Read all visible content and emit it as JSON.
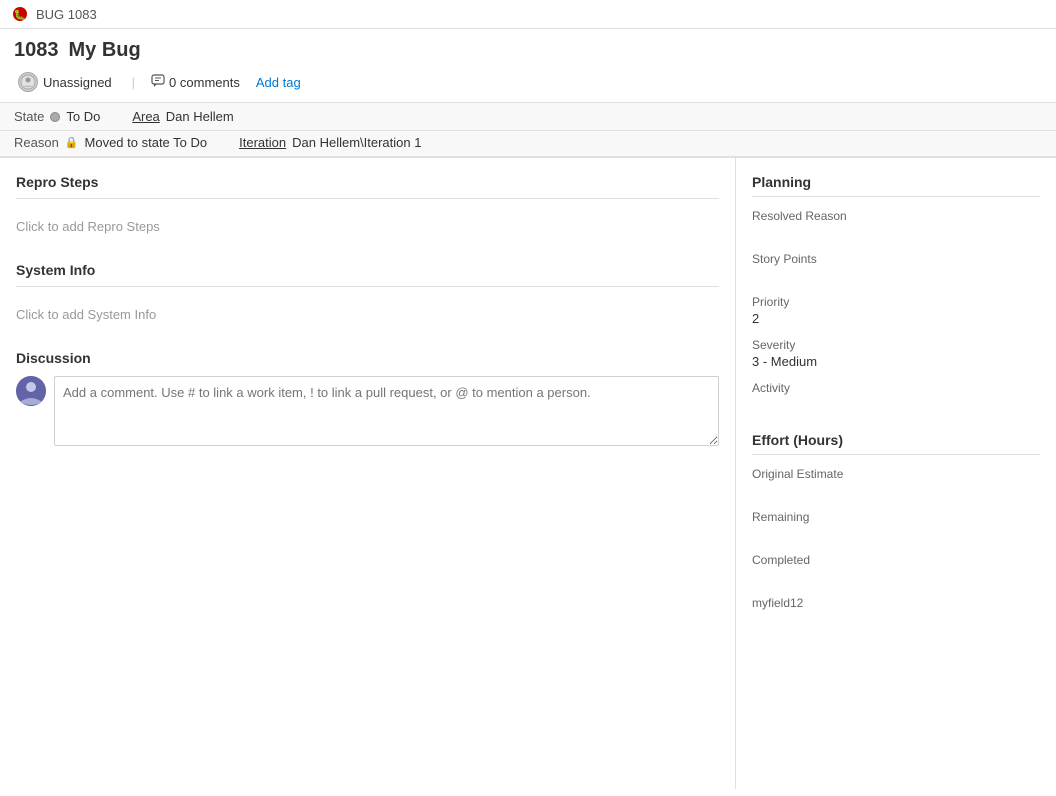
{
  "titleBar": {
    "bugLabel": "BUG 1083",
    "bugIconColor": "#cc0000"
  },
  "workItem": {
    "id": "1083",
    "title": "My Bug",
    "assignedTo": "Unassigned",
    "commentsCount": "0 comments",
    "addTagLabel": "Add tag"
  },
  "fields": {
    "stateLabel": "State",
    "stateValue": "To Do",
    "areaLabel": "Area",
    "areaValue": "Dan Hellem",
    "reasonLabel": "Reason",
    "reasonValue": "Moved to state To Do",
    "iterationLabel": "Iteration",
    "iterationValue": "Dan Hellem\\Iteration 1"
  },
  "leftPane": {
    "reproStepsTitle": "Repro Steps",
    "reproStepsPlaceholder": "Click to add Repro Steps",
    "systemInfoTitle": "System Info",
    "systemInfoPlaceholder": "Click to add System Info",
    "discussionTitle": "Discussion",
    "commentPlaceholder": "Add a comment. Use # to link a work item, ! to link a pull request, or @ to mention a person."
  },
  "rightPane": {
    "planningTitle": "Planning",
    "resolvedReasonLabel": "Resolved Reason",
    "resolvedReasonValue": "",
    "storyPointsLabel": "Story Points",
    "storyPointsValue": "",
    "priorityLabel": "Priority",
    "priorityValue": "2",
    "severityLabel": "Severity",
    "severityValue": "3 - Medium",
    "activityLabel": "Activity",
    "activityValue": "",
    "effortTitle": "Effort (Hours)",
    "originalEstimateLabel": "Original Estimate",
    "originalEstimateValue": "",
    "remainingLabel": "Remaining",
    "remainingValue": "",
    "completedLabel": "Completed",
    "completedValue": "",
    "myfield12Label": "myfield12",
    "myfield12Value": ""
  }
}
